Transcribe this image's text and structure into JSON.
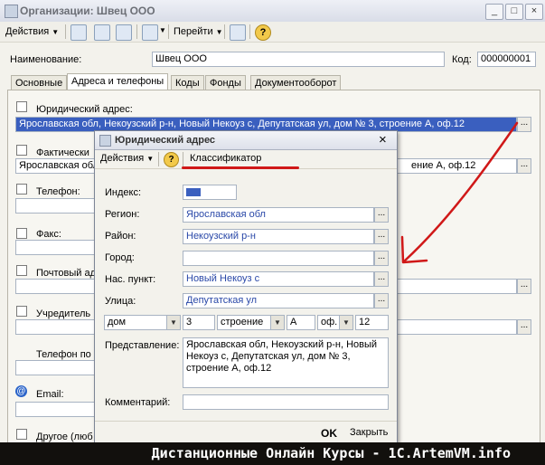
{
  "window": {
    "title": "Организации: Швец ООО",
    "min_glyph": "_",
    "max_glyph": "□",
    "close_glyph": "×"
  },
  "toolbar": {
    "actions": "Действия",
    "goto": "Перейти",
    "help": "?"
  },
  "form": {
    "name_label": "Наименование:",
    "name_value": "Швец ООО",
    "code_label": "Код:",
    "code_value": "000000001"
  },
  "tabs": [
    "Основные",
    "Адреса и телефоны",
    "Коды",
    "Фонды",
    "Документооборот"
  ],
  "address_rows": {
    "legal_label": "Юридический адрес:",
    "legal_value": "Ярославская обл, Некоузский р-н, Новый Некоуз с, Депутатская ул, дом № 3, строение А, оф.12",
    "actual_label": "Фактически",
    "actual_left": "Ярославская обл",
    "actual_right": "ение А, оф.12",
    "phone_label": "Телефон:",
    "fax_label": "Факс:",
    "postal_label": "Почтовый ад",
    "founder_label": "Учредитель",
    "phone2_label": "Телефон по",
    "email_label": "Email:",
    "other_label": "Другое (люб"
  },
  "dialog": {
    "title": "Юридический адрес",
    "actions": "Действия",
    "help": "?",
    "classifier": "Классификатор",
    "index_label": "Индекс:",
    "region_label": "Регион:",
    "region_value": "Ярославская обл",
    "district_label": "Район:",
    "district_value": "Некоузский р-н",
    "city_label": "Город:",
    "city_value": "",
    "settlement_label": "Нас. пункт:",
    "settlement_value": "Новый Некоуз с",
    "street_label": "Улица:",
    "street_value": "Депутатская ул",
    "house_type": "дом",
    "house_num": "3",
    "building_type": "строение",
    "building_num": "А",
    "office_type": "оф.",
    "office_num": "12",
    "presentation_label": "Представление:",
    "presentation_value": "Ярославская обл, Некоузский р-н, Новый Некоуз с, Депутатская ул, дом № 3, строение А, оф.12",
    "comment_label": "Комментарий:",
    "ok": "OK",
    "close": "Закрыть",
    "close_glyph": "×"
  },
  "footer": {
    "text": "Дистанционные Онлайн Курсы - 1С.ArtemVM.info"
  },
  "colors": {
    "accent": "#3a5fbf",
    "annotation": "#d01818",
    "value_text": "#2a48a8"
  }
}
